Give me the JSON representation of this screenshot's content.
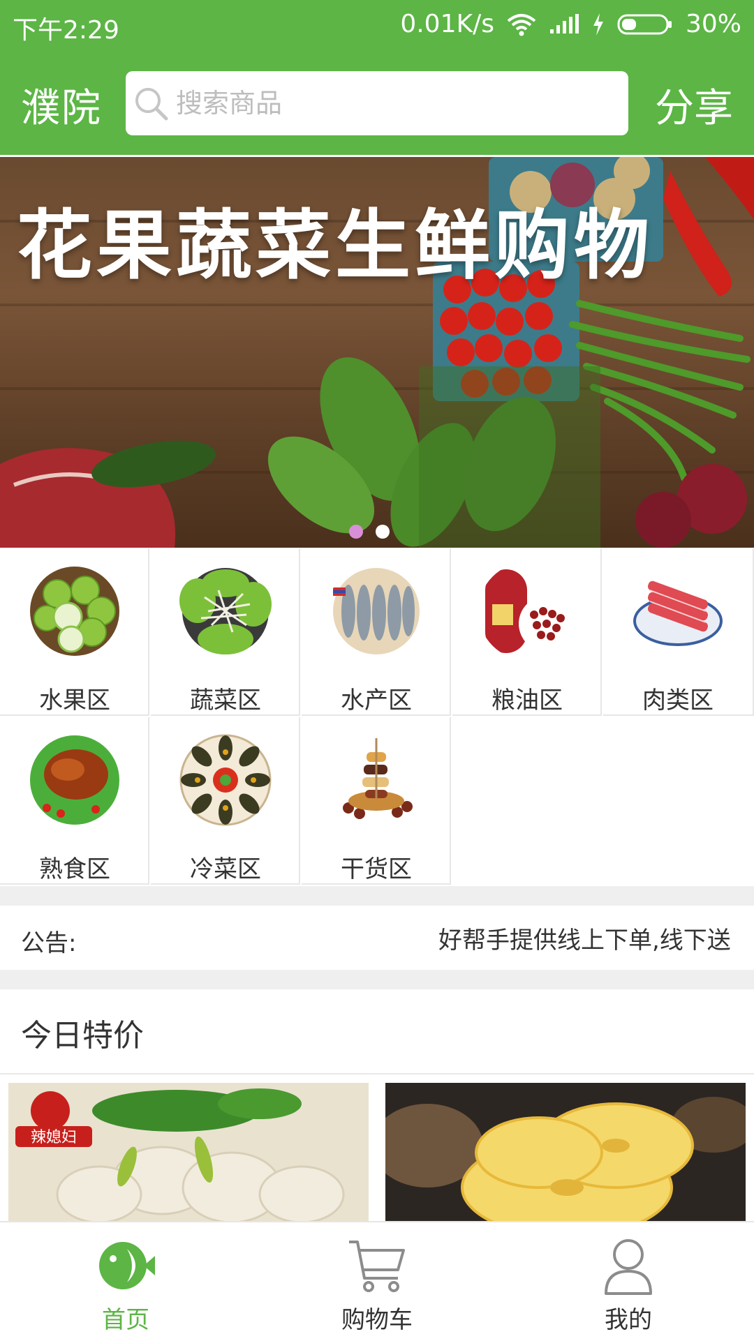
{
  "status": {
    "time": "下午2:29",
    "speed": "0.01K/s",
    "battery": "30%"
  },
  "header": {
    "city": "濮院",
    "search_placeholder": "搜索商品",
    "share": "分享"
  },
  "banner": {
    "title": "花果蔬菜生鲜购物",
    "slides": 2,
    "active_slide": 1
  },
  "categories": [
    {
      "label": "水果区",
      "icon": "limes-icon"
    },
    {
      "label": "蔬菜区",
      "icon": "vegetable-salad-icon"
    },
    {
      "label": "水产区",
      "icon": "shrimp-icon"
    },
    {
      "label": "粮油区",
      "icon": "beans-icon"
    },
    {
      "label": "肉类区",
      "icon": "meat-icon"
    },
    {
      "label": "熟食区",
      "icon": "roast-chicken-icon"
    },
    {
      "label": "冷菜区",
      "icon": "preserved-egg-icon"
    },
    {
      "label": "干货区",
      "icon": "dried-food-icon"
    }
  ],
  "notice": {
    "label": "公告:",
    "text": "好帮手提供线上下单,线下送"
  },
  "special": {
    "title": "今日特价",
    "products": [
      {
        "brand": "辣媳妇",
        "image": "pickled-chicken-feet-image"
      },
      {
        "image": "pineapple-image"
      }
    ]
  },
  "nav": [
    {
      "label": "首页",
      "icon": "home-fish-icon",
      "active": true
    },
    {
      "label": "购物车",
      "icon": "cart-icon",
      "active": false
    },
    {
      "label": "我的",
      "icon": "user-icon",
      "active": false
    }
  ],
  "colors": {
    "primary": "#5cb545",
    "background_gap": "#efefef",
    "dot_active": "#d98fd7"
  }
}
